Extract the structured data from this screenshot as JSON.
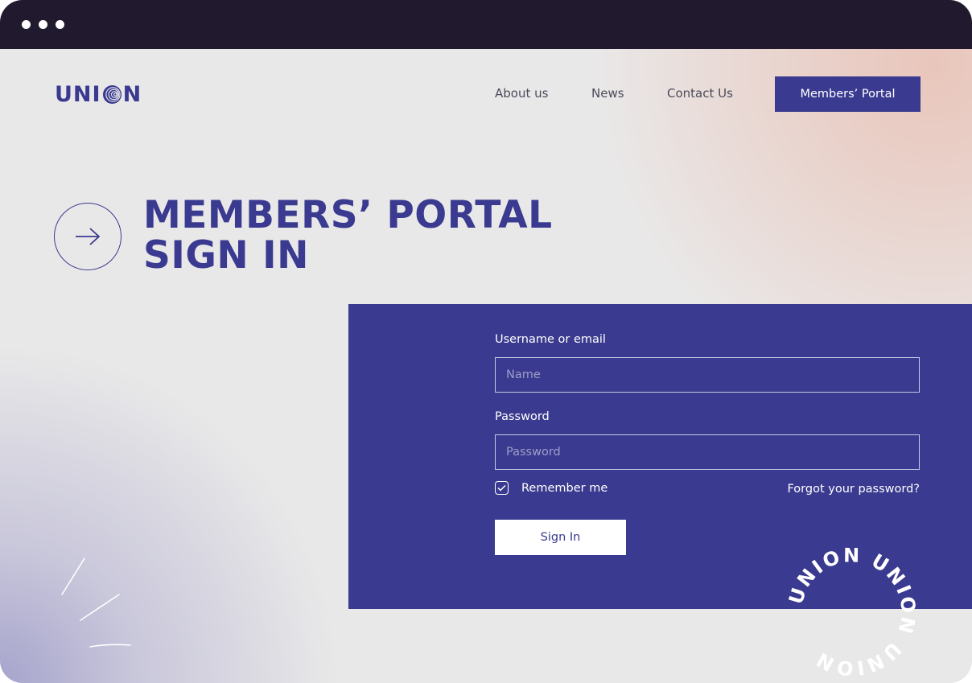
{
  "window": {
    "controls": [
      "dot",
      "dot",
      "dot"
    ]
  },
  "header": {
    "logo_text_left": "UNI",
    "logo_text_right": "N",
    "nav": [
      {
        "label": "About us"
      },
      {
        "label": "News"
      },
      {
        "label": "Contact Us"
      }
    ],
    "portal_button": "Members’ Portal"
  },
  "hero": {
    "title_line1": "MEMBERS’ PORTAL",
    "title_line2": "SIGN IN",
    "icon": "arrow-right-icon"
  },
  "form": {
    "username_label": "Username or email",
    "username_placeholder": "Name",
    "password_label": "Password",
    "password_placeholder": "Password",
    "remember_label": "Remember me",
    "remember_checked": true,
    "forgot_link": "Forgot your password?",
    "submit_label": "Sign In"
  },
  "badge": {
    "ring_text": "UNION UNION UNION"
  },
  "colors": {
    "brand": "#3a3a90",
    "titlebar": "#211a2e",
    "background": "#e9e8e8",
    "accent_glow": "#e9c4b9"
  }
}
